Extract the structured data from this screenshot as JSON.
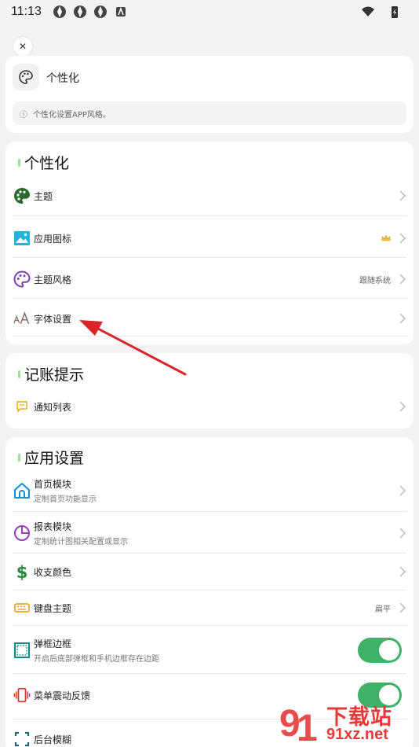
{
  "status": {
    "time": "11:13"
  },
  "header": {
    "title": "个性化",
    "info": "个性化设置APP风格。"
  },
  "sections": {
    "personalization": {
      "title": "个性化",
      "items": [
        {
          "label": "主题",
          "value": ""
        },
        {
          "label": "应用图标",
          "value": ""
        },
        {
          "label": "主题风格",
          "value": "跟随系统"
        },
        {
          "label": "字体设置",
          "value": ""
        }
      ]
    },
    "reminder": {
      "title": "记账提示",
      "items": [
        {
          "label": "通知列表"
        }
      ]
    },
    "app": {
      "title": "应用设置",
      "items": [
        {
          "label": "首页模块",
          "sub": "定制首页功能显示"
        },
        {
          "label": "报表模块",
          "sub": "定制统计图相关配置或显示"
        },
        {
          "label": "收支颜色",
          "sub": ""
        },
        {
          "label": "键盘主题",
          "value": "扁平"
        },
        {
          "label": "弹框边框",
          "sub": "开启后底部弹框和手机边框存在边距",
          "toggle": true
        },
        {
          "label": "菜单震动反馈",
          "toggle": true
        },
        {
          "label": "后台模糊"
        }
      ]
    }
  },
  "watermark": {
    "top": "下载站",
    "bottom": "91xz.net"
  },
  "colors": {
    "accent": "#3fb168",
    "arrow": "#d9262b"
  }
}
